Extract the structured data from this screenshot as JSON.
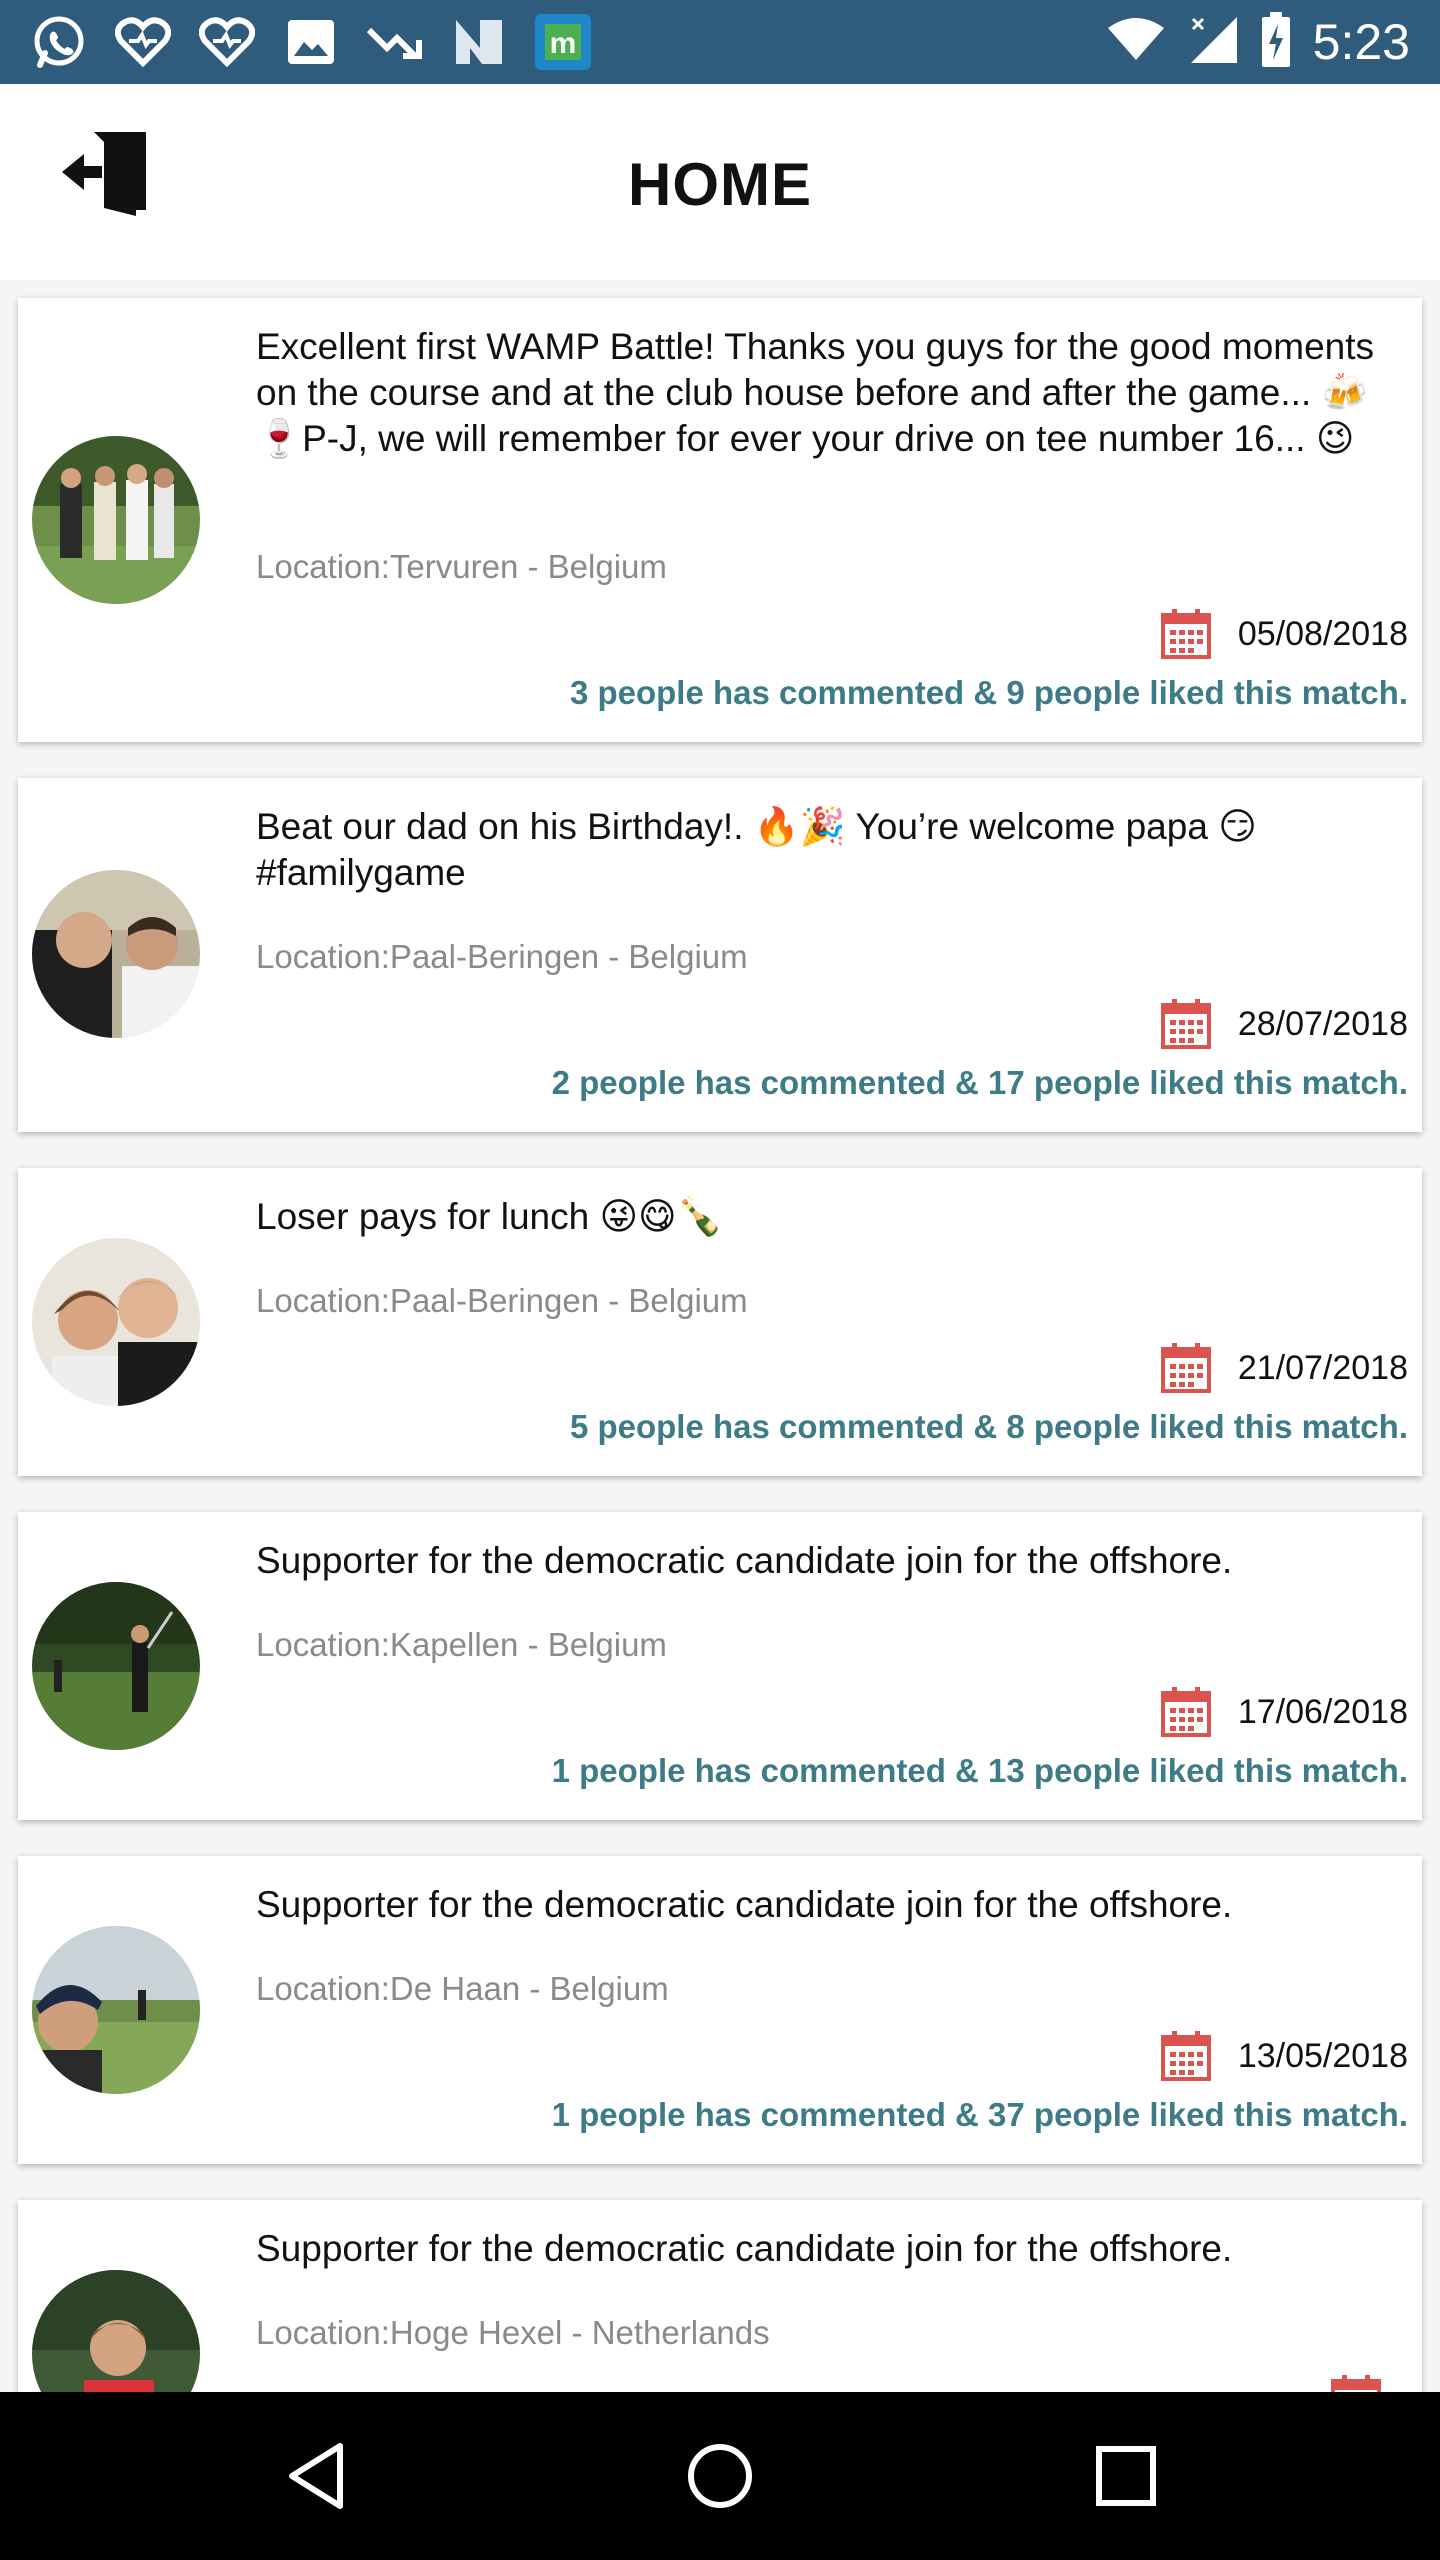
{
  "status_bar": {
    "time": "5:23",
    "left_icons": [
      "whatsapp-icon",
      "heart-icon",
      "heart-icon",
      "image-icon",
      "trend-icon",
      "n-icon",
      "m-icon"
    ],
    "right_icons": [
      "wifi-icon",
      "signal-icon",
      "battery-charging-icon"
    ]
  },
  "header": {
    "title": "HOME",
    "exit_icon": "logout-door-icon"
  },
  "colors": {
    "status_bar": "#2f5b7d",
    "stats_text": "#3d7b86",
    "calendar": "#d9534f",
    "location_text": "#8a8a8a"
  },
  "posts": [
    {
      "text": "Excellent first WAMP Battle! Thanks you guys for the good moments on the course and at the club house before and after the game...  🍻🍷P-J, we will remember for ever your drive on tee number 16... 😉",
      "location": "Location:Tervuren - Belgium",
      "date": "05/08/2018",
      "stats": "3 people has commented & 9 people liked this match."
    },
    {
      "text": "Beat our dad on his Birthday!. 🔥🎉 You’re welcome papa 😏 #familygame",
      "location": "Location:Paal-Beringen - Belgium",
      "date": "28/07/2018",
      "stats": "2 people has commented & 17 people liked this match."
    },
    {
      "text": "Loser pays for lunch 😜😋🍾",
      "location": "Location:Paal-Beringen - Belgium",
      "date": "21/07/2018",
      "stats": "5 people has commented & 8 people liked this match."
    },
    {
      "text": "Supporter for the democratic candidate join for the offshore.",
      "location": "Location:Kapellen - Belgium",
      "date": "17/06/2018",
      "stats": "1 people has commented & 13 people liked this match."
    },
    {
      "text": "Supporter for the democratic candidate join for the offshore.",
      "location": "Location:De Haan - Belgium",
      "date": "13/05/2018",
      "stats": "1 people has commented & 37 people liked this match."
    },
    {
      "text": "Supporter for the democratic candidate join for the offshore.",
      "location": "Location:Hoge Hexel - Netherlands",
      "date": "",
      "stats": ""
    }
  ],
  "nav_bar": {
    "buttons": [
      "back-icon",
      "home-icon",
      "recents-icon"
    ]
  }
}
